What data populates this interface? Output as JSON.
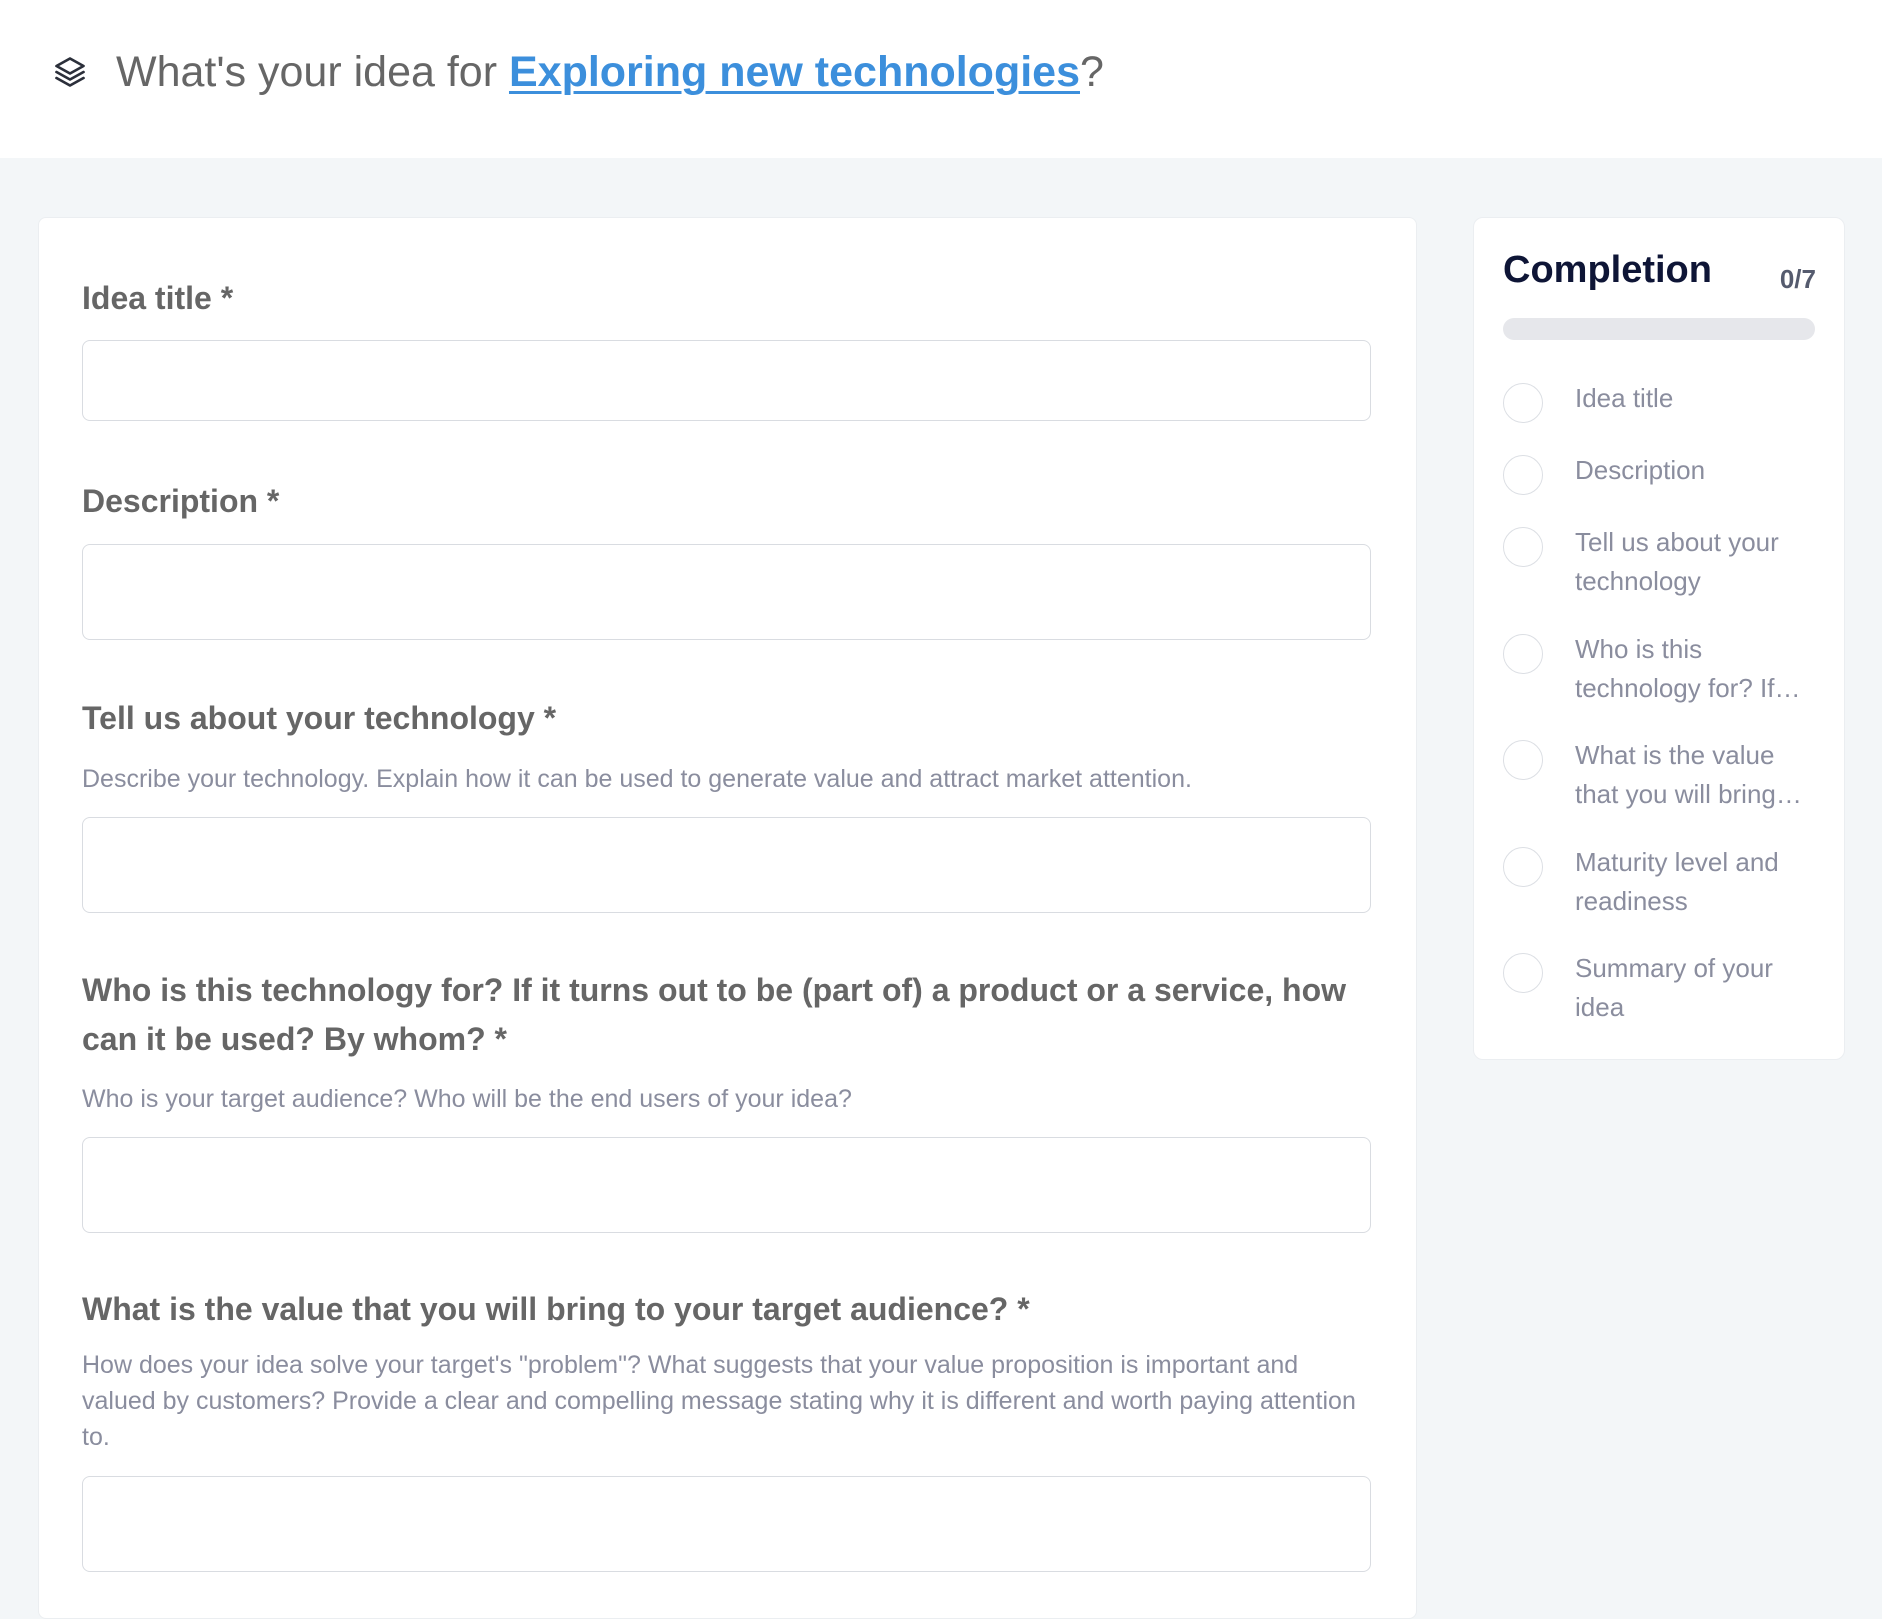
{
  "header": {
    "title_prefix": "What's your idea for ",
    "title_link": "Exploring new technologies",
    "title_suffix": "?",
    "icon": "layers-icon"
  },
  "form": {
    "fields": [
      {
        "label": "Idea title *",
        "help": "",
        "value": "",
        "placeholder": ""
      },
      {
        "label": "Description *",
        "help": "",
        "value": "",
        "placeholder": ""
      },
      {
        "label": "Tell us about your technology *",
        "help": "Describe your technology. Explain how it can be used to generate value and attract market attention.",
        "value": "",
        "placeholder": ""
      },
      {
        "label": "Who is this technology for? If it turns out to be (part of) a product or a service, how can it be used? By whom? *",
        "help": "Who is your target audience? Who will be the end users of your idea?",
        "value": "",
        "placeholder": ""
      },
      {
        "label": "What is the value that you will bring to your target audience? *",
        "help": "How does your idea solve your target's \"problem\"? What suggests that your value proposition is important and valued by customers? Provide a clear and compelling message stating why it is different and worth paying attention to.",
        "value": "",
        "placeholder": ""
      }
    ]
  },
  "completion": {
    "title": "Completion",
    "count": "0/7",
    "progress_fraction": 0,
    "items": [
      {
        "label": "Idea title"
      },
      {
        "label": "Description"
      },
      {
        "label": "Tell us about your technology"
      },
      {
        "label": "Who is this technology for? If…"
      },
      {
        "label": "What is the value that you will bring…"
      },
      {
        "label": "Maturity level and readiness"
      },
      {
        "label": "Summary of your idea"
      }
    ]
  },
  "colors": {
    "accent_link": "#3c8fdc",
    "page_background": "#f3f6f8",
    "heading_dark": "#0e1536"
  }
}
